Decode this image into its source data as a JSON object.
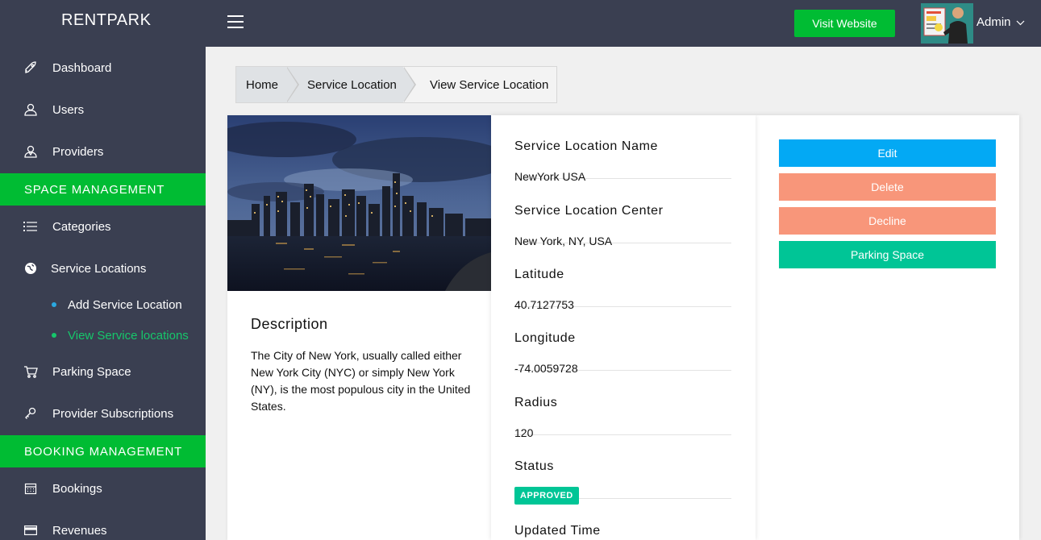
{
  "brand": "RENTPARK",
  "sidebar": {
    "items": [
      {
        "label": "Dashboard",
        "icon": "rocket-icon"
      },
      {
        "label": "Users",
        "icon": "user-icon"
      },
      {
        "label": "Providers",
        "icon": "provider-icon"
      }
    ],
    "sections": [
      {
        "label": "SPACE MANAGEMENT"
      },
      {
        "label": "BOOKING MANAGEMENT"
      }
    ],
    "space_items": [
      {
        "label": "Categories",
        "icon": "list-icon"
      },
      {
        "label": "Service Locations",
        "icon": "globe-icon"
      }
    ],
    "sub_items": [
      {
        "label": "Add Service Location",
        "active": false
      },
      {
        "label": "View Service locations",
        "active": true
      }
    ],
    "more_items": [
      {
        "label": "Parking Space",
        "icon": "cart-icon"
      },
      {
        "label": "Provider Subscriptions",
        "icon": "key-icon"
      }
    ],
    "booking_items": [
      {
        "label": "Bookings",
        "icon": "calendar-icon"
      },
      {
        "label": "Revenues",
        "icon": "card-icon"
      }
    ]
  },
  "topbar": {
    "visit_label": "Visit Website",
    "admin_label": "Admin"
  },
  "breadcrumb": [
    "Home",
    "Service Location",
    "View Service Location"
  ],
  "description": {
    "title": "Description",
    "text": "The City of New York, usually called either New York City (NYC) or simply New York (NY), is the most populous city in the United States."
  },
  "details": {
    "name_label": "Service Location Name",
    "name_value": "NewYork USA",
    "center_label": "Service Location Center",
    "center_value": "New York, NY, USA",
    "lat_label": "Latitude",
    "lat_value": "40.7127753",
    "lng_label": "Longitude",
    "lng_value": "-74.0059728",
    "radius_label": "Radius",
    "radius_value": "120",
    "status_label": "Status",
    "status_value": "APPROVED",
    "updated_label": "Updated Time"
  },
  "actions": {
    "edit": "Edit",
    "delete": "Delete",
    "decline": "Decline",
    "parking": "Parking Space"
  },
  "colors": {
    "sidebar_bg": "#3a3f51",
    "accent_green": "#00bc33",
    "edit_blue": "#03a9f4",
    "salmon": "#f8967a",
    "teal": "#00c596",
    "active_sub": "#16c76b"
  }
}
